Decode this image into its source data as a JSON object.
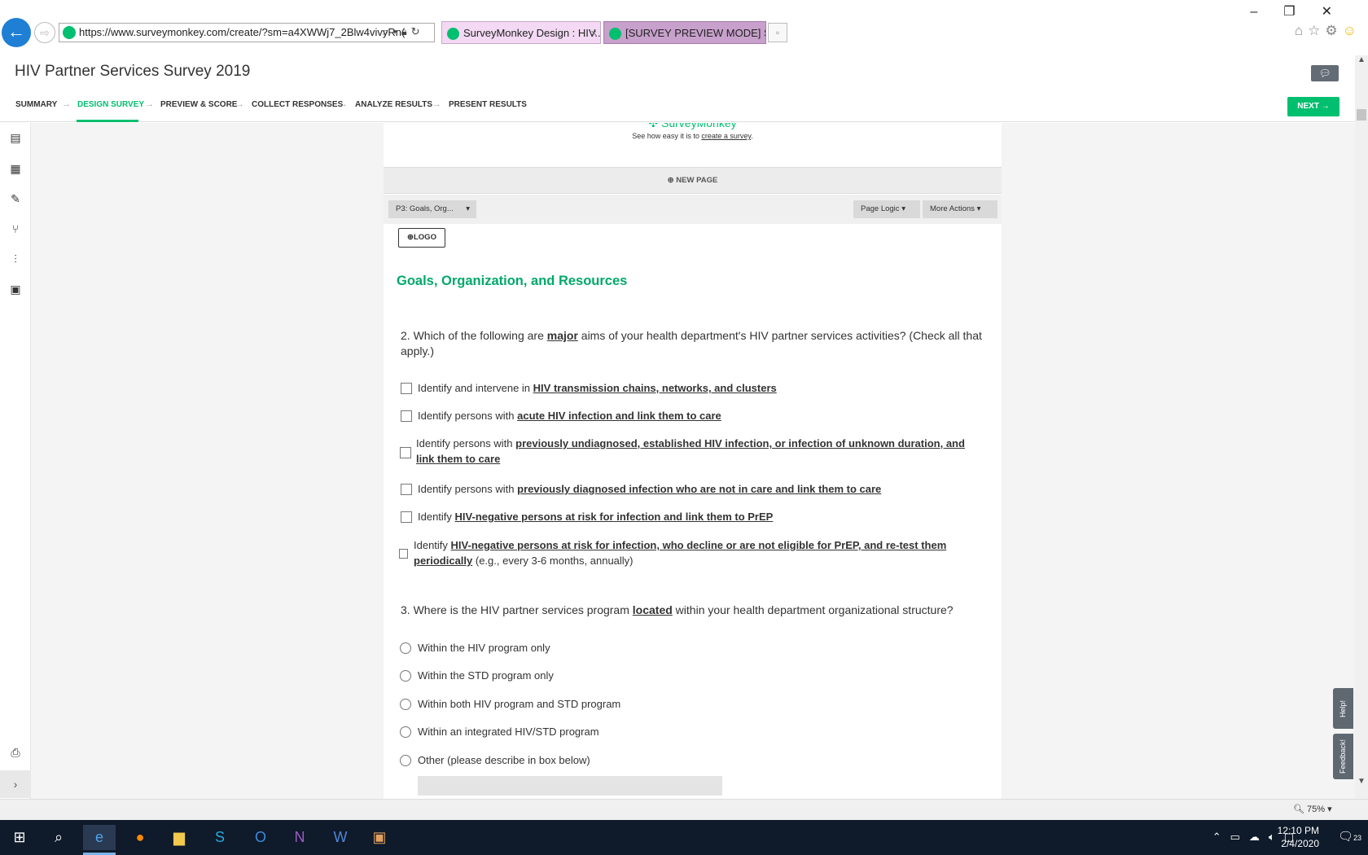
{
  "browser": {
    "url": "https://www.surveymonkey.com/create/?sm=a4XWWj7_2Blw4vivyRn(",
    "tabs": [
      {
        "label": "SurveyMonkey Design : HIV...",
        "close": "×"
      },
      {
        "label": "[SURVEY PREVIEW MODE] Surv..."
      }
    ],
    "zoom": "75%"
  },
  "app": {
    "survey_title": "HIV Partner Services Survey 2019",
    "nav": [
      {
        "label": "SUMMARY"
      },
      {
        "label": "DESIGN SURVEY"
      },
      {
        "label": "PREVIEW & SCORE"
      },
      {
        "label": "COLLECT RESPONSES"
      },
      {
        "label": "ANALYZE RESULTS"
      },
      {
        "label": "PRESENT RESULTS"
      }
    ],
    "next_label": "NEXT"
  },
  "survey": {
    "brand": "SurveyMonkey",
    "promo_prefix": "See how easy it is to ",
    "promo_link": "create a survey",
    "promo_suffix": ".",
    "new_page": "NEW PAGE",
    "page_selector": "P3: Goals, Org...",
    "page_logic": "Page Logic",
    "more_actions": "More Actions",
    "logo": "LOGO",
    "page_title": "Goals, Organization, and Resources",
    "q2": {
      "pre": "2. Which of the following are ",
      "bold": "major",
      "post": " aims of your health department's HIV partner services activities? (Check all that apply.)",
      "options": [
        {
          "pre": "Identify and intervene in ",
          "bold": "HIV transmission chains, networks, and clusters",
          "post": ""
        },
        {
          "pre": "Identify persons with ",
          "bold": "acute HIV infection and link them to care",
          "post": ""
        },
        {
          "pre": "Identify persons with ",
          "bold": "previously undiagnosed, established HIV infection, or infection of unknown duration, and link them to care",
          "post": ""
        },
        {
          "pre": "Identify persons with ",
          "bold": "previously diagnosed infection who are not in care and link them to care",
          "post": ""
        },
        {
          "pre": "Identify ",
          "bold": "HIV-negative persons at risk for infection and link them to PrEP",
          "post": ""
        },
        {
          "pre": "Identify ",
          "bold": "HIV-negative persons at  risk for infection, who decline or are not eligible for PrEP, and re-test them periodically",
          "post": " (e.g., every 3-6 months, annually)"
        }
      ]
    },
    "q3": {
      "pre": "3. Where is the HIV partner services program ",
      "bold": "located",
      "post": " within your health department organizational structure?",
      "options": [
        "Within the HIV program only",
        "Within the STD program only",
        "Within both HIV program and STD program",
        "Within an integrated HIV/STD program",
        "Other (please describe in box below)"
      ]
    },
    "help": "Help!",
    "feedback": "Feedback!"
  },
  "taskbar": {
    "time": "12:10 PM",
    "date": "2/4/2020",
    "notifications": "23"
  },
  "colors": {
    "accent": "#00bf6f",
    "title_green": "#00a86b",
    "taskbar": "#0f1a2a"
  }
}
